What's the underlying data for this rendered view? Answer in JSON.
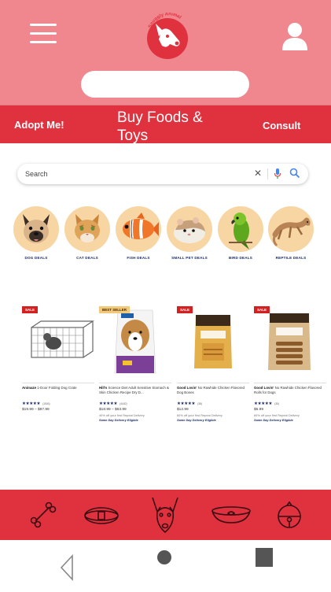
{
  "header": {
    "logo_text": "Snuggly Animal",
    "search_placeholder": ""
  },
  "nav": {
    "left": "Adopt Me!",
    "center": "Buy Foods & Toys",
    "right": "Consult"
  },
  "search": {
    "placeholder": "Search"
  },
  "categories": [
    {
      "label": "DOG DEALS",
      "icon": "dog-icon"
    },
    {
      "label": "CAT DEALS",
      "icon": "cat-icon"
    },
    {
      "label": "FISH DEALS",
      "icon": "fish-icon"
    },
    {
      "label": "SMALL PET DEALS",
      "icon": "hamster-icon"
    },
    {
      "label": "BIRD DEALS",
      "icon": "bird-icon"
    },
    {
      "label": "REPTILE DEALS",
      "icon": "reptile-icon"
    }
  ],
  "products": [
    {
      "badge": "SALE",
      "brand": "Animaze",
      "title": " 1-Door Folding Dog Crate",
      "rating_count": "(1506)",
      "price": "$19.99 – $87.99",
      "promo": "",
      "delivery": ""
    },
    {
      "badge": "BEST SELLER",
      "brand": "Hill's",
      "title": " Science Diet Adult Sensitive Stomach & Skin Chicken Recipe Dry D...",
      "rating_count": "(4442)",
      "price": "$18.99 – $63.99",
      "promo": "40% off your first Repeat Delivery",
      "delivery": "Same Day Delivery Eligible"
    },
    {
      "badge": "SALE",
      "brand": "Good Lovin'",
      "title": " No Rawhide Chicken Flavored Dog Bones",
      "rating_count": "(38)",
      "price": "$12.99",
      "promo": "60% off your first Repeat Delivery",
      "delivery": "Same Day Delivery Eligible"
    },
    {
      "badge": "SALE",
      "brand": "Good Lovin'",
      "title": " No Rawhide Chicken Flavored Rolls for Dogs",
      "rating_count": "(35)",
      "price": "$5.99",
      "promo": "60% off your first Repeat Delivery",
      "delivery": "Same Day Delivery Eligible"
    }
  ],
  "tabbar": [
    {
      "icon": "bone-icon"
    },
    {
      "icon": "collar-icon"
    },
    {
      "icon": "dog-head-icon"
    },
    {
      "icon": "food-bowl-icon"
    },
    {
      "icon": "bell-toy-icon"
    }
  ],
  "colors": {
    "header_pink": "#f0868e",
    "nav_red": "#e0313f",
    "brand_navy": "#1b2a6b"
  }
}
